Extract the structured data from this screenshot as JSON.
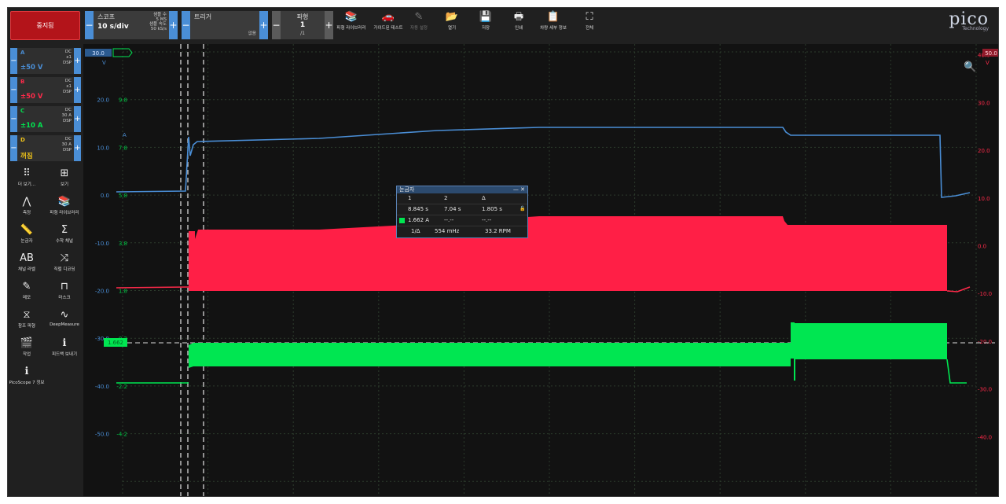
{
  "toolbar": {
    "stop_label": "중지됨",
    "scope": {
      "title": "스코프",
      "timebase": "10 s/div",
      "samples_label": "샘플 수",
      "samples_value": "5 MS",
      "rate_label": "샘플 속도",
      "rate_value": "50 kS/s"
    },
    "trigger": {
      "title": "트리거",
      "mode": "없음"
    },
    "waveform": {
      "title": "파형",
      "index": "1",
      "total": "/1"
    },
    "tools": [
      {
        "icon": "waveform-library-icon",
        "glyph": "📚",
        "label": "파형 라이브러리"
      },
      {
        "icon": "guided-test-icon",
        "glyph": "🚗",
        "label": "가이드된 테스트"
      },
      {
        "icon": "auto-setup-icon",
        "glyph": "✎",
        "label": "자동 설정"
      },
      {
        "icon": "open-folder-icon",
        "glyph": "📂",
        "label": "열기"
      },
      {
        "icon": "save-icon",
        "glyph": "💾",
        "label": "저장"
      },
      {
        "icon": "print-icon",
        "glyph": "🖶",
        "label": "인쇄"
      },
      {
        "icon": "vehicle-details-icon",
        "glyph": "📋",
        "label": "차량 세부 정보"
      },
      {
        "icon": "fullscreen-icon",
        "glyph": "⛶",
        "label": "전체"
      }
    ],
    "logo_text": "pico",
    "logo_sub": "Technology"
  },
  "channels": [
    {
      "name": "A",
      "range": "±50 V",
      "coupling": "DC",
      "probe": "x1",
      "mode": "DSP",
      "color": "#4a8ed6"
    },
    {
      "name": "B",
      "range": "±50 V",
      "coupling": "DC",
      "probe": "x1",
      "mode": "DSP",
      "color": "#ff2a4a"
    },
    {
      "name": "C",
      "range": "±10 A",
      "coupling": "DC",
      "probe": "30 A",
      "mode": "DSP",
      "color": "#00e651"
    },
    {
      "name": "D",
      "range": "꺼짐",
      "coupling": "DC",
      "probe": "30 A",
      "mode": "DSP",
      "color": "#f0c419"
    }
  ],
  "side_tools": [
    {
      "icon": "more-views-icon",
      "glyph": "⠿",
      "label": "더 보기..."
    },
    {
      "icon": "view-grid-icon",
      "glyph": "⊞",
      "label": "보기"
    },
    {
      "icon": "measure-icon",
      "glyph": "⋀",
      "label": "측정"
    },
    {
      "icon": "waveform-library-icon",
      "glyph": "📚",
      "label": "파형 라이브러리"
    },
    {
      "icon": "ruler-icon",
      "glyph": "📏",
      "label": "눈금자"
    },
    {
      "icon": "math-channel-icon",
      "glyph": "Σ",
      "label": "수학 채널"
    },
    {
      "icon": "channel-labels-icon",
      "glyph": "AB",
      "label": "채널 라벨"
    },
    {
      "icon": "serial-decode-icon",
      "glyph": "⤨",
      "label": "직렬 디코딩"
    },
    {
      "icon": "notes-icon",
      "glyph": "✎",
      "label": "메모"
    },
    {
      "icon": "mask-icon",
      "glyph": "⊓",
      "label": "마스크"
    },
    {
      "icon": "reference-waveform-icon",
      "glyph": "⧖",
      "label": "참조 파형"
    },
    {
      "icon": "deepmeasure-icon",
      "glyph": "∿",
      "label": "DeepMeasure"
    },
    {
      "icon": "action-icon",
      "glyph": "🎬",
      "label": "작업"
    },
    {
      "icon": "feedback-icon",
      "glyph": "ℹ",
      "label": "피드백 보내기"
    },
    {
      "icon": "about-icon",
      "glyph": "ℹ",
      "label": "PicoScope 7 정보"
    }
  ],
  "axes": {
    "left_a": [
      "20.0",
      "10.0",
      "0.0",
      "-10.0",
      "-20.0",
      "-30.0",
      "-40.0",
      "-50.0"
    ],
    "left_c": [
      "9.8",
      "7.8",
      "5.8",
      "3.8",
      "1.8",
      "-0.2",
      "-2.2",
      "-4.2"
    ],
    "right_b": [
      "40.0",
      "30.0",
      "20.0",
      "10.0",
      "0.0",
      "-10.0",
      "-20.0",
      "-30.0",
      "-40.0"
    ],
    "left_unit": "V",
    "right_unit": "V",
    "a_marker": "A",
    "top_left_badge": "30.0",
    "top_right_badge": "50.0",
    "ruler_level_badge": "1.662"
  },
  "ruler_window": {
    "title": "눈금자",
    "col1": "1",
    "col2": "2",
    "col3": "Δ",
    "t1": "8.845 s",
    "t2": "7.04 s",
    "dt": "1.805 s",
    "value": "1.662 A",
    "v2": "--.--",
    "vd": "--.--",
    "inv_label": "1/Δ",
    "freq": "554 mHz",
    "rpm": "33.2 RPM"
  }
}
